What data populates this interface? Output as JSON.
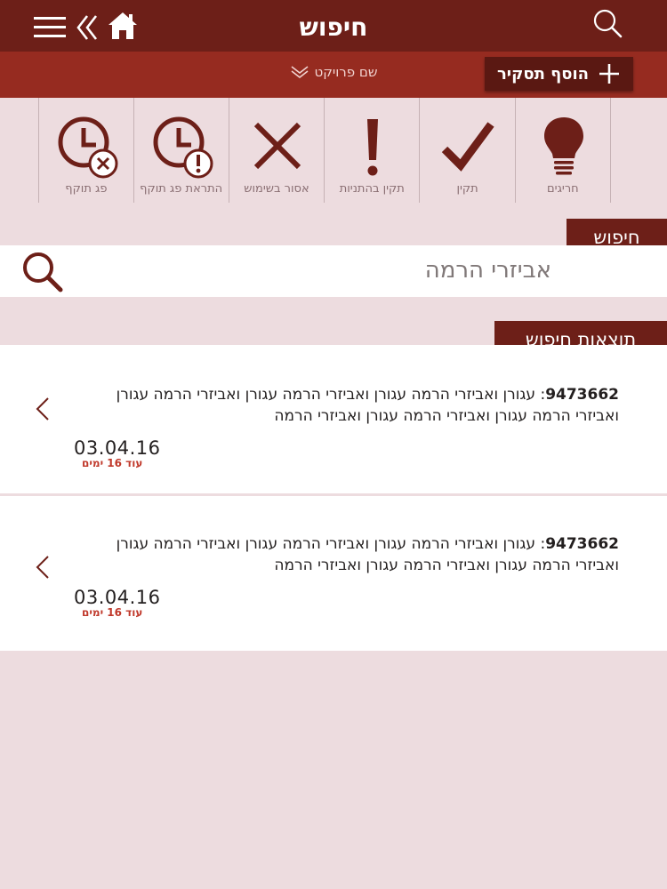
{
  "header": {
    "title": "חיפוש",
    "menu_icon": "hamburger-icon",
    "back_icon": "double-chevron-left-icon",
    "home_icon": "home-icon",
    "search_icon": "magnifier-icon"
  },
  "subheader": {
    "project_label": "שם פרויקט",
    "add_report_label": "הוסף תסקיר"
  },
  "filters": [
    {
      "label": "חריגים",
      "icon": "lightbulb-icon"
    },
    {
      "label": "תקין",
      "icon": "check-icon"
    },
    {
      "label": "תקין בהתניות",
      "icon": "exclamation-icon"
    },
    {
      "label": "אסור בשימוש",
      "icon": "x-icon"
    },
    {
      "label": "התראת פג תוקף",
      "icon": "clock-alert-icon"
    },
    {
      "label": "פג תוקף",
      "icon": "clock-expired-icon"
    }
  ],
  "search": {
    "tab_label": "חיפוש",
    "query": "אביזרי הרמה"
  },
  "results": {
    "tab_label": "תוצאות חיפוש",
    "items": [
      {
        "id": "9473662",
        "separator": ": ",
        "text": "עגורן ואביזרי הרמה  עגורן ואביזרי הרמה עגורן ואביזרי הרמה עגורן ואביזרי הרמה עגורן ואביזרי הרמה עגורן ואביזרי הרמה",
        "date": "03.04.16",
        "remaining": "עוד 16 ימים"
      },
      {
        "id": "9473662",
        "separator": ": ",
        "text": "עגורן ואביזרי הרמה  עגורן ואביזרי הרמה עגורן ואביזרי הרמה עגורן ואביזרי הרמה עגורן ואביזרי הרמה עגורן ואביזרי הרמה",
        "date": "03.04.16",
        "remaining": "עוד 16 ימים"
      }
    ]
  },
  "colors": {
    "header_bg": "#6d1f18",
    "subheader_bg": "#962b20",
    "page_bg": "#eddcdf",
    "icon_color": "#6d1f18",
    "alert_red": "#c0392b"
  }
}
